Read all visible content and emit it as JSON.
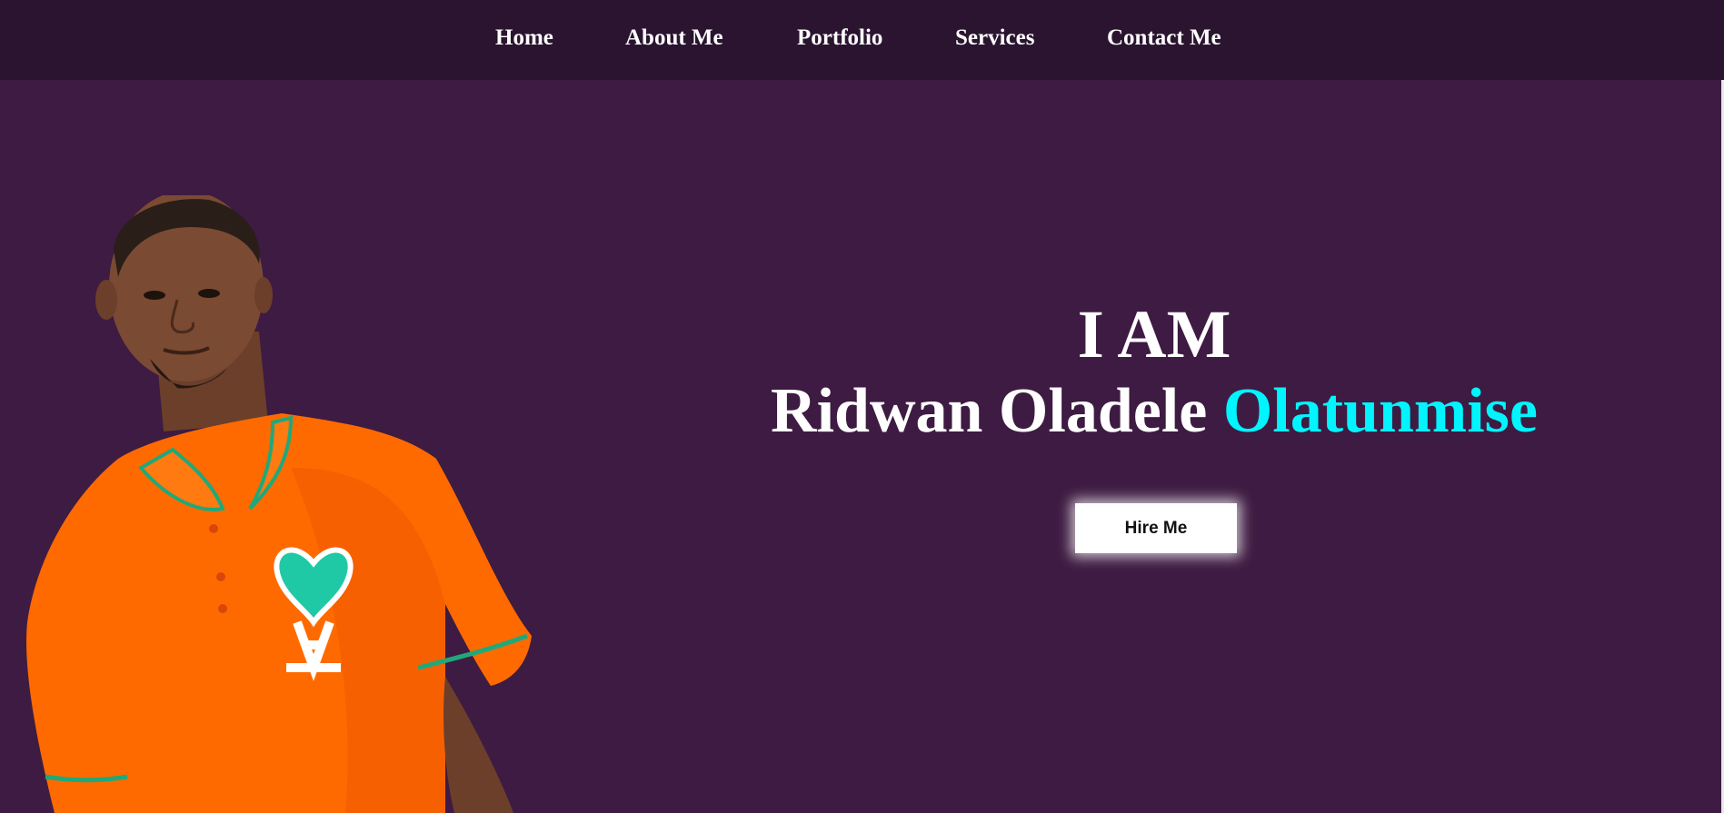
{
  "nav": {
    "items": [
      {
        "label": "Home"
      },
      {
        "label": "About Me"
      },
      {
        "label": "Portfolio"
      },
      {
        "label": "Services"
      },
      {
        "label": "Contact Me"
      }
    ]
  },
  "hero": {
    "line1": "I AM",
    "name_first": "Ridwan Oladele ",
    "name_accent": "Olatunmise",
    "cta_label": "Hire Me"
  },
  "colors": {
    "nav_bg": "#2b1430",
    "page_bg": "#3e1b42",
    "accent": "#00f5ff",
    "shirt": "#ff6a00",
    "badge": "#1fc9a6"
  }
}
